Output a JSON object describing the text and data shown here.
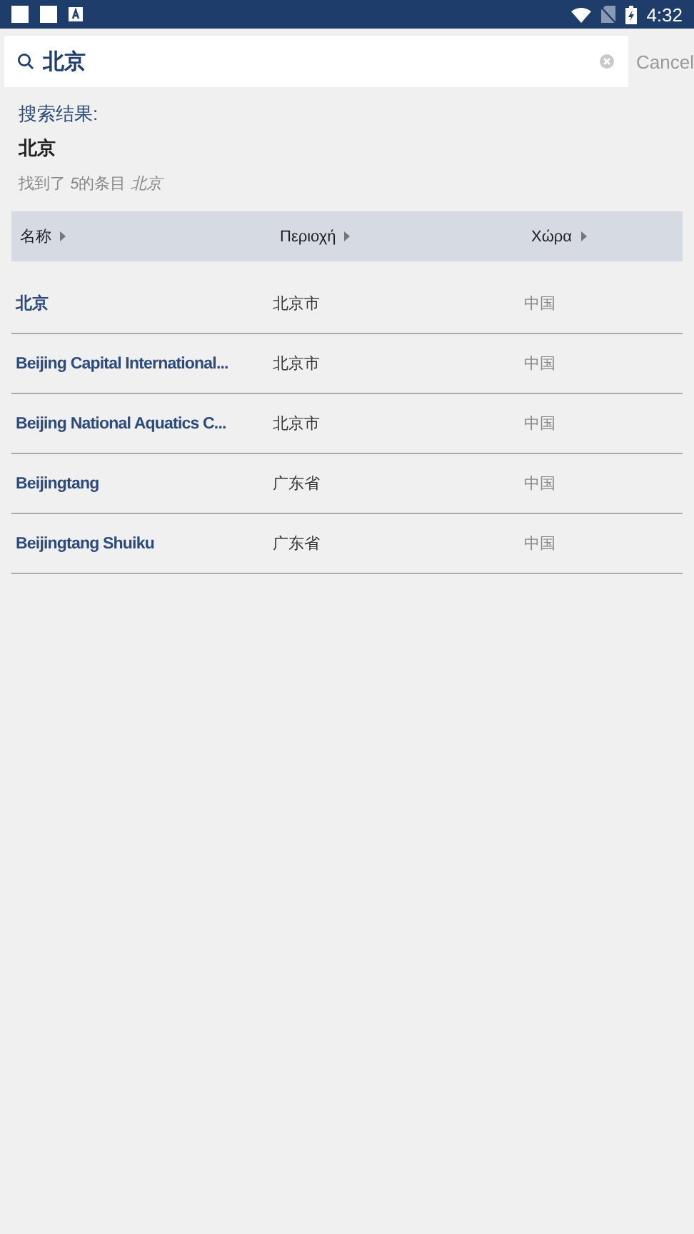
{
  "status_bar": {
    "time": "4:32"
  },
  "search": {
    "value": "北京",
    "cancel": "Cancel"
  },
  "results": {
    "heading": "搜索结果:",
    "query": "北京",
    "summary": {
      "prefix": "找到了 ",
      "count": "5",
      "middle": "的条目 ",
      "term": "北京"
    }
  },
  "table": {
    "columns": [
      "名称",
      "Περιοχή",
      "Χώρα"
    ],
    "rows": [
      {
        "name": "北京",
        "region": "北京市",
        "country": "中国"
      },
      {
        "name": "Beijing Capital International...",
        "region": "北京市",
        "country": "中国"
      },
      {
        "name": "Beijing National Aquatics C...",
        "region": "北京市",
        "country": "中国"
      },
      {
        "name": "Beijingtang",
        "region": "广东省",
        "country": "中国"
      },
      {
        "name": "Beijingtang Shuiku",
        "region": "广东省",
        "country": "中国"
      }
    ]
  }
}
